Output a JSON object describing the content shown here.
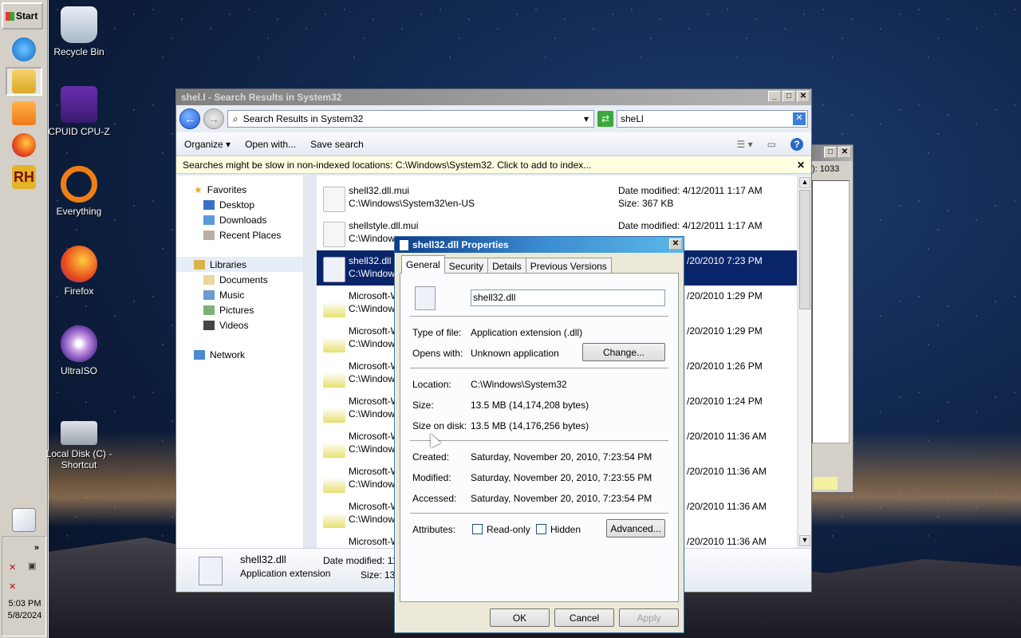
{
  "taskbar": {
    "start_label": "Start",
    "clock_time": "5:03 PM",
    "clock_date": "5/8/2024",
    "tray_chevron": "»"
  },
  "desktop_icons": [
    {
      "label": "Recycle Bin",
      "icon": "recycle-bin-icon"
    },
    {
      "label": "CPUID CPU-Z",
      "icon": "cpuz-icon"
    },
    {
      "label": "Everything",
      "icon": "everything-icon"
    },
    {
      "label": "Firefox",
      "icon": "firefox-icon"
    },
    {
      "label": "UltraISO",
      "icon": "ultraiso-icon"
    },
    {
      "label": "Local Disk (C) - Shortcut",
      "icon": "disk-icon"
    }
  ],
  "explorer": {
    "title": "shel.l - Search Results in System32",
    "address": "Search Results in System32",
    "search_value": "sheLl",
    "toolbar": {
      "organize": "Organize",
      "open_with": "Open with...",
      "save_search": "Save search"
    },
    "info_message": "Searches might be slow in non-indexed locations: C:\\Windows\\System32. Click to add to index...",
    "nav": {
      "favorites": "Favorites",
      "desktop": "Desktop",
      "downloads": "Downloads",
      "recent": "Recent Places",
      "libraries": "Libraries",
      "documents": "Documents",
      "music": "Music",
      "pictures": "Pictures",
      "videos": "Videos",
      "network": "Network"
    },
    "files": [
      {
        "name": "shell32.dll.mui",
        "path": "C:\\Windows\\System32\\en-US",
        "date": "Date modified: 4/12/2011 1:17 AM",
        "size": "Size: 367 KB"
      },
      {
        "name": "shellstyle.dll.mui",
        "path": "C:\\Windows",
        "date": "Date modified: 4/12/2011 1:17 AM",
        "size": ""
      },
      {
        "name": "shell32.dll",
        "path": "C:\\Windows",
        "date": "/20/2010 7:23 PM",
        "size": ""
      },
      {
        "name": "Microsoft-W",
        "path": "C:\\Windows",
        "date": "/20/2010 1:29 PM",
        "size": ""
      },
      {
        "name": "Microsoft-W",
        "path": "C:\\Windows",
        "date": "/20/2010 1:29 PM",
        "size": ""
      },
      {
        "name": "Microsoft-W",
        "path": "C:\\Windows",
        "date": "/20/2010 1:26 PM",
        "size": ""
      },
      {
        "name": "Microsoft-W",
        "path": "C:\\Windows",
        "date": "/20/2010 1:24 PM",
        "size": ""
      },
      {
        "name": "Microsoft-W",
        "path": "C:\\Windows",
        "date": "/20/2010 11:36 AM",
        "size": ""
      },
      {
        "name": "Microsoft-W",
        "path": "C:\\Windows",
        "date": "/20/2010 11:36 AM",
        "size": ""
      },
      {
        "name": "Microsoft-W",
        "path": "C:\\Windows",
        "date": "/20/2010 11:36 AM",
        "size": ""
      },
      {
        "name": "Microsoft-W",
        "path": "",
        "date": "/20/2010 11:36 AM",
        "size": ""
      }
    ],
    "details": {
      "name": "shell32.dll",
      "type": "Application extension",
      "date": "Date modified: 11/",
      "size": "Size: 13."
    }
  },
  "bg_window": {
    "partial_text": "): 1033"
  },
  "properties": {
    "title": "shell32.dll Properties",
    "tabs": [
      "General",
      "Security",
      "Details",
      "Previous Versions"
    ],
    "filename": "shell32.dll",
    "type_label": "Type of file:",
    "type_value": "Application extension (.dll)",
    "opens_label": "Opens with:",
    "opens_value": "Unknown application",
    "change_button": "Change...",
    "location_label": "Location:",
    "location_value": "C:\\Windows\\System32",
    "size_label": "Size:",
    "size_value": "13.5 MB (14,174,208 bytes)",
    "disk_label": "Size on disk:",
    "disk_value": "13.5 MB (14,176,256 bytes)",
    "created_label": "Created:",
    "created_value": "Saturday, November 20, 2010, 7:23:54 PM",
    "modified_label": "Modified:",
    "modified_value": "Saturday, November 20, 2010, 7:23:55 PM",
    "accessed_label": "Accessed:",
    "accessed_value": "Saturday, November 20, 2010, 7:23:54 PM",
    "attributes_label": "Attributes:",
    "readonly_label": "Read-only",
    "hidden_label": "Hidden",
    "advanced_button": "Advanced...",
    "ok": "OK",
    "cancel": "Cancel",
    "apply": "Apply"
  }
}
